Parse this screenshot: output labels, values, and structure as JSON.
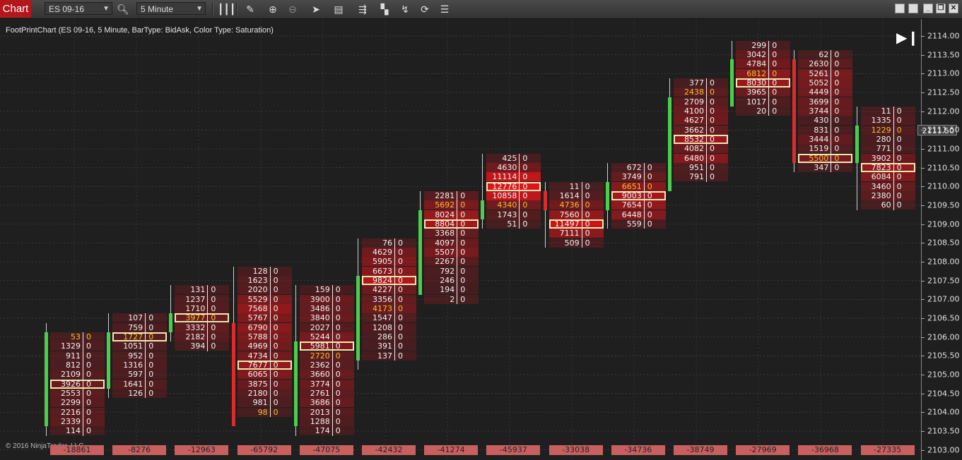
{
  "toolbar": {
    "tab_label": "Chart",
    "instrument": "ES 09-16",
    "interval": "5 Minute",
    "icons": [
      "search-icon",
      "bar-style-icon",
      "draw-pencil-icon",
      "zoom-in-icon",
      "zoom-out-icon",
      "pointer-icon",
      "data-box-icon",
      "strategy-icon",
      "properties-icon",
      "drawing-tools-icon",
      "refresh-icon",
      "list-icon"
    ]
  },
  "chart": {
    "title": "FootPrintChart (ES 09-16, 5 Minute, BarType: BidAsk, Color Type: Saturation)",
    "copyright": "© 2016 NinjaTrader, LLC",
    "current_price": "2111.50",
    "y_ticks": [
      "2114.00",
      "2113.50",
      "2113.00",
      "2112.50",
      "2112.00",
      "2111.50",
      "2111.00",
      "2110.50",
      "2110.00",
      "2109.50",
      "2109.00",
      "2108.50",
      "2108.00",
      "2107.50",
      "2107.00",
      "2106.50",
      "2106.00",
      "2105.50",
      "2105.00",
      "2104.50",
      "2104.00",
      "2103.50",
      "2103.00"
    ],
    "colors": {
      "up": "#4ccd4c",
      "down": "#e02a2a",
      "poc_border": "#f5e7b0",
      "highlight_text": "#f2c12e",
      "delta_bg": "#c86060"
    }
  },
  "chart_data": {
    "type": "footprint",
    "tick_size": 0.25,
    "bars": [
      {
        "open": 2103.75,
        "close": 2106.0,
        "high": 2106.25,
        "low": 2103.5,
        "top": 2106.0,
        "vol": [
          "53",
          "1329",
          "911",
          "812",
          "2109",
          "3926",
          "2553",
          "2299",
          "2216",
          "2339",
          "114"
        ],
        "ask": [
          "0",
          "0",
          "0",
          "0",
          "0",
          "0",
          "0",
          "0",
          "0",
          "0",
          "0"
        ],
        "poc": 5,
        "hl": [
          0
        ],
        "delta": "-18861"
      },
      {
        "open": 2104.75,
        "close": 2106.0,
        "high": 2106.5,
        "low": 2104.5,
        "top": 2106.5,
        "vol": [
          "107",
          "759",
          "1727",
          "1051",
          "952",
          "1316",
          "597",
          "1641",
          "126"
        ],
        "ask": [
          "0",
          "0",
          "0",
          "0",
          "0",
          "0",
          "0",
          "0",
          "0"
        ],
        "poc": 2,
        "hl": [
          2
        ],
        "delta": "-8276"
      },
      {
        "open": 2106.25,
        "close": 2106.5,
        "high": 2107.25,
        "low": 2106.0,
        "top": 2107.25,
        "vol": [
          "131",
          "1237",
          "1710",
          "3977",
          "3332",
          "2182",
          "394"
        ],
        "ask": [
          "0",
          "0",
          "0",
          "0",
          "0",
          "0",
          "0"
        ],
        "poc": 3,
        "hl": [
          3
        ],
        "delta": "-12963"
      },
      {
        "open": 2106.25,
        "close": 2103.75,
        "high": 2107.75,
        "low": 2103.75,
        "top": 2107.75,
        "vol": [
          "128",
          "1623",
          "2020",
          "5529",
          "7568",
          "5767",
          "6790",
          "5788",
          "4969",
          "4734",
          "7677",
          "6065",
          "3875",
          "2180",
          "981",
          "98"
        ],
        "ask": [
          "0",
          "0",
          "0",
          "0",
          "0",
          "0",
          "0",
          "0",
          "0",
          "0",
          "0",
          "0",
          "0",
          "0",
          "0",
          "0"
        ],
        "poc": 10,
        "hl": [
          15
        ],
        "delta": "-65792"
      },
      {
        "open": 2103.75,
        "close": 2105.75,
        "high": 2107.25,
        "low": 2103.5,
        "top": 2107.25,
        "vol": [
          "159",
          "3900",
          "3486",
          "3840",
          "2027",
          "5244",
          "5981",
          "2720",
          "2362",
          "3660",
          "3774",
          "2761",
          "3686",
          "2013",
          "1288",
          "174"
        ],
        "ask": [
          "0",
          "0",
          "0",
          "0",
          "0",
          "0",
          "0",
          "0",
          "0",
          "0",
          "0",
          "0",
          "0",
          "0",
          "0",
          "0"
        ],
        "poc": 6,
        "hl": [
          7
        ],
        "delta": "-47075"
      },
      {
        "open": 2105.5,
        "close": 2107.5,
        "high": 2108.5,
        "low": 2105.25,
        "top": 2108.5,
        "vol": [
          "76",
          "4629",
          "5905",
          "6673",
          "9824",
          "4227",
          "3356",
          "4173",
          "1547",
          "1208",
          "286",
          "391",
          "137"
        ],
        "ask": [
          "0",
          "0",
          "0",
          "0",
          "0",
          "0",
          "0",
          "0",
          "0",
          "0",
          "0",
          "0",
          "0"
        ],
        "poc": 4,
        "hl": [
          7
        ],
        "delta": "-42432"
      },
      {
        "open": 2107.25,
        "close": 2109.25,
        "high": 2109.75,
        "low": 2107.25,
        "top": 2109.75,
        "vol": [
          "2281",
          "5692",
          "8024",
          "8804",
          "3368",
          "4097",
          "5507",
          "2267",
          "792",
          "246",
          "194",
          "2"
        ],
        "ask": [
          "0",
          "0",
          "0",
          "0",
          "0",
          "0",
          "0",
          "0",
          "0",
          "0",
          "0",
          "0"
        ],
        "poc": 3,
        "hl": [
          1
        ],
        "delta": "-41274"
      },
      {
        "open": 2109.25,
        "close": 2109.5,
        "high": 2110.75,
        "low": 2109.0,
        "top": 2110.75,
        "vol": [
          "425",
          "4630",
          "11114",
          "12776",
          "10858",
          "4340",
          "1743",
          "51"
        ],
        "ask": [
          "0",
          "0",
          "0",
          "0",
          "0",
          "0",
          "0",
          "0"
        ],
        "poc": 3,
        "hl": [
          5
        ],
        "delta": "-45937"
      },
      {
        "open": 2109.75,
        "close": 2109.5,
        "high": 2110.0,
        "low": 2108.5,
        "top": 2110.0,
        "vol": [
          "11",
          "1614",
          "4736",
          "7560",
          "11497",
          "7111",
          "509"
        ],
        "ask": [
          "0",
          "0",
          "0",
          "0",
          "0",
          "0",
          "0"
        ],
        "poc": 4,
        "hl": [
          2
        ],
        "delta": "-33038"
      },
      {
        "open": 2109.5,
        "close": 2110.0,
        "high": 2110.5,
        "low": 2109.0,
        "top": 2110.5,
        "vol": [
          "672",
          "3749",
          "6651",
          "9003",
          "7654",
          "6448",
          "559"
        ],
        "ask": [
          "0",
          "0",
          "0",
          "0",
          "0",
          "0",
          "0"
        ],
        "poc": 3,
        "hl": [
          2
        ],
        "delta": "-34736"
      },
      {
        "open": 2110.0,
        "close": 2112.25,
        "high": 2112.75,
        "low": 2110.0,
        "top": 2112.75,
        "vol": [
          "377",
          "2438",
          "2709",
          "4100",
          "4627",
          "3662",
          "8532",
          "4082",
          "6480",
          "951",
          "791"
        ],
        "ask": [
          "0",
          "0",
          "0",
          "0",
          "0",
          "0",
          "0",
          "0",
          "0",
          "0",
          "0"
        ],
        "poc": 6,
        "hl": [
          1
        ],
        "delta": "-38749"
      },
      {
        "open": 2112.25,
        "close": 2113.25,
        "high": 2113.75,
        "low": 2112.25,
        "top": 2113.75,
        "vol": [
          "299",
          "3042",
          "4784",
          "6812",
          "8030",
          "3965",
          "1017",
          "20"
        ],
        "ask": [
          "0",
          "0",
          "0",
          "0",
          "0",
          "0",
          "0",
          "0"
        ],
        "poc": 4,
        "hl": [
          3
        ],
        "delta": "-27969"
      },
      {
        "open": 2113.25,
        "close": 2110.75,
        "high": 2113.5,
        "low": 2110.5,
        "top": 2113.5,
        "vol": [
          "62",
          "2630",
          "5261",
          "5052",
          "4449",
          "3699",
          "3744",
          "430",
          "831",
          "3444",
          "1519",
          "5500",
          "347"
        ],
        "ask": [
          "0",
          "0",
          "0",
          "0",
          "0",
          "0",
          "0",
          "0",
          "0",
          "0",
          "0",
          "0",
          "0"
        ],
        "poc": 11,
        "hl": [
          11
        ],
        "delta": "-36968"
      },
      {
        "open": 2110.75,
        "close": 2111.5,
        "high": 2112.0,
        "low": 2109.5,
        "top": 2112.0,
        "vol": [
          "11",
          "1335",
          "1229",
          "280",
          "771",
          "3902",
          "7823",
          "6084",
          "3460",
          "2380",
          "60"
        ],
        "ask": [
          "0",
          "0",
          "0",
          "0",
          "0",
          "0",
          "0",
          "0",
          "0",
          "0",
          "0"
        ],
        "poc": 6,
        "hl": [
          2
        ],
        "delta": "-27335"
      }
    ]
  }
}
